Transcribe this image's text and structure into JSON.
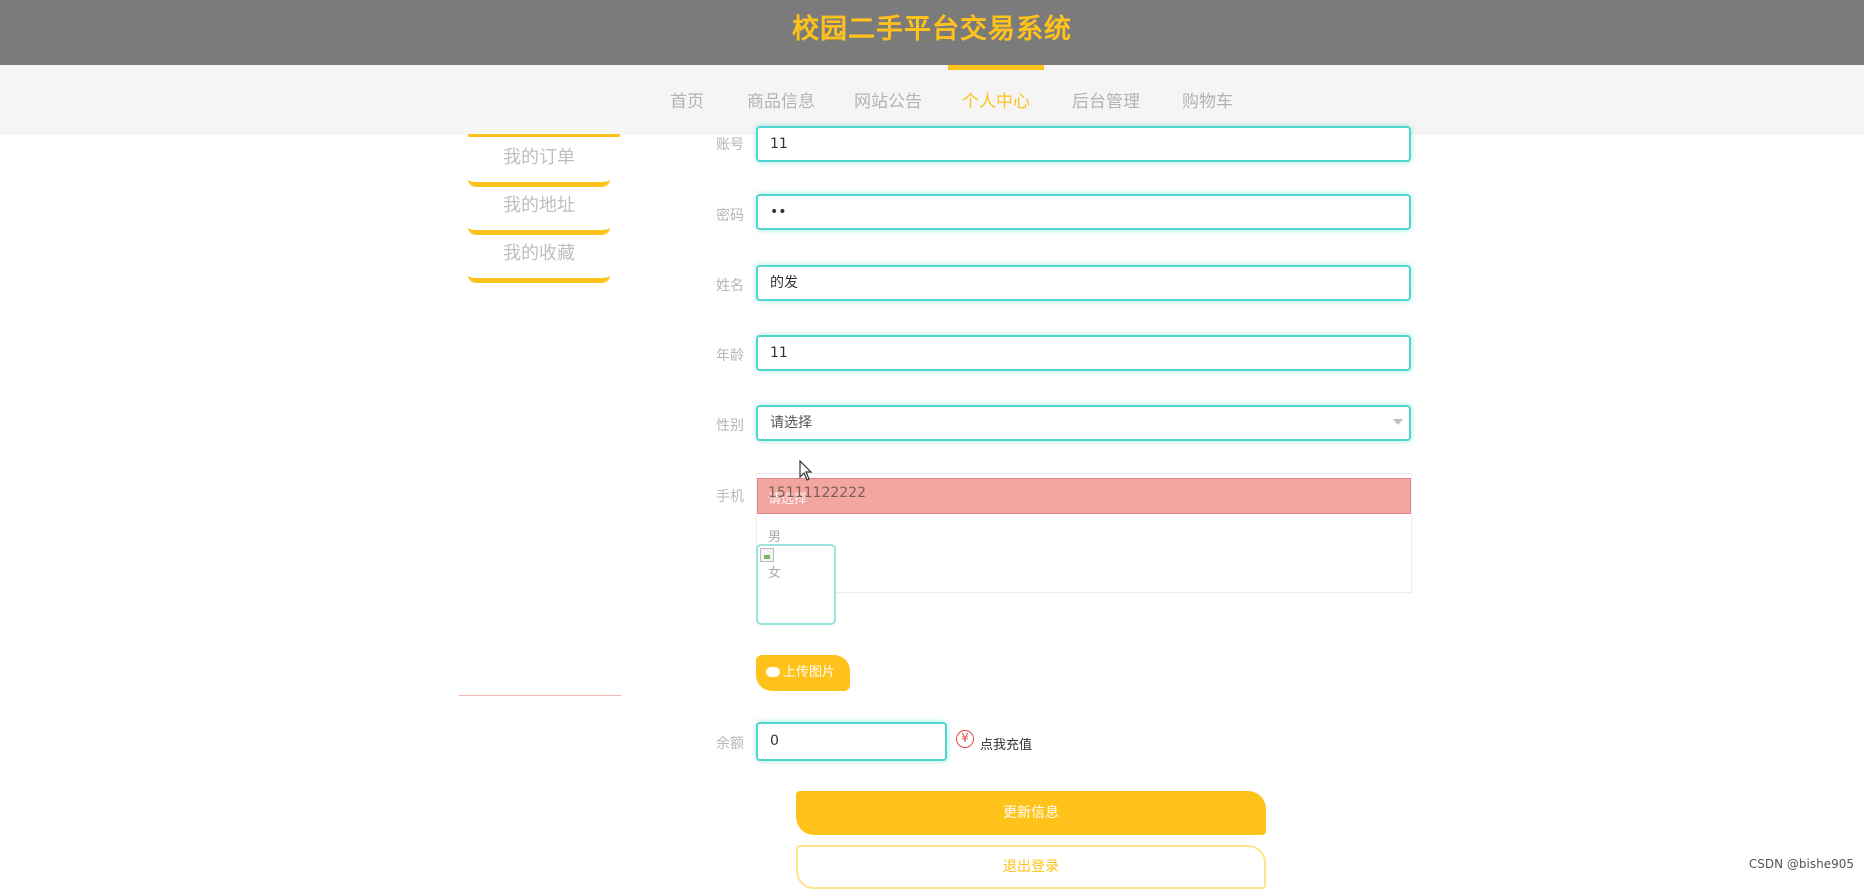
{
  "header": {
    "title": "校园二手平台交易系统"
  },
  "nav": {
    "items": [
      {
        "label": "首页",
        "active": false
      },
      {
        "label": "商品信息",
        "active": false
      },
      {
        "label": "网站公告",
        "active": false
      },
      {
        "label": "个人中心",
        "active": true
      },
      {
        "label": "后台管理",
        "active": false
      },
      {
        "label": "购物车",
        "active": false
      }
    ],
    "accent_color": "#ffc21a"
  },
  "sidebar": {
    "items": [
      {
        "label": "我的订单"
      },
      {
        "label": "我的地址"
      },
      {
        "label": "我的收藏"
      }
    ]
  },
  "form": {
    "account": {
      "label": "账号",
      "value": "11"
    },
    "password": {
      "label": "密码",
      "value": "••"
    },
    "name": {
      "label": "姓名",
      "value": "的发"
    },
    "age": {
      "label": "年龄",
      "value": "11"
    },
    "gender": {
      "label": "性别",
      "placeholder": "请选择",
      "options": [
        "请选择",
        "男",
        "女"
      ]
    },
    "phone": {
      "label": "手机",
      "value": "15111122222"
    },
    "upload_label": "上传图片",
    "balance": {
      "label": "余额",
      "value": "0"
    },
    "recharge_label": "点我充值",
    "recharge_icon": "yen-icon",
    "update_label": "更新信息",
    "logout_label": "退出登录"
  },
  "watermark": "CSDN @bishe905"
}
